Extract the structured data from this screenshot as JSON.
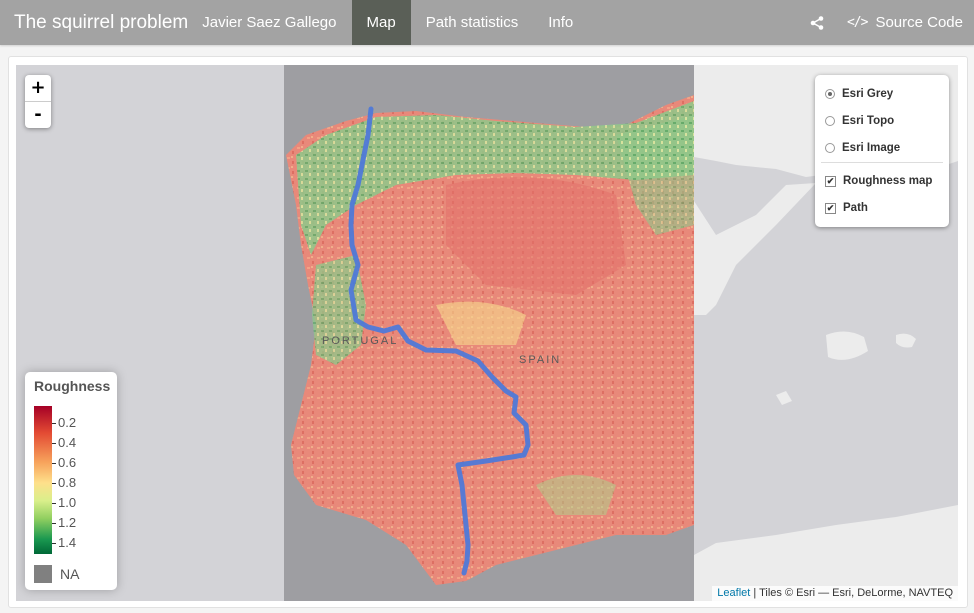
{
  "navbar": {
    "title": "The squirrel problem",
    "author": "Javier Saez Gallego",
    "tabs": [
      {
        "label": "Map",
        "active": true
      },
      {
        "label": "Path statistics",
        "active": false
      },
      {
        "label": "Info",
        "active": false
      }
    ],
    "share_icon": "share-icon",
    "source_icon_glyph": "</>",
    "source_label": "Source Code"
  },
  "map": {
    "zoom_in": "+",
    "zoom_out": "-",
    "country_labels": [
      "PORTUGAL",
      "SPAIN"
    ],
    "layers": {
      "base": [
        {
          "label": "Esri Grey",
          "selected": true
        },
        {
          "label": "Esri Topo",
          "selected": false
        },
        {
          "label": "Esri Image",
          "selected": false
        }
      ],
      "overlays": [
        {
          "label": "Roughness map",
          "checked": true
        },
        {
          "label": "Path",
          "checked": true
        }
      ]
    },
    "attribution": {
      "link": "Leaflet",
      "text": " | Tiles © Esri — Esri, DeLorme, NAVTEQ"
    },
    "colors": {
      "path": "#4f79d8",
      "sea": "#d3d3d7",
      "land_outside": "#ececec",
      "roughness_bg": "#e77b6e"
    }
  },
  "legend": {
    "title": "Roughness",
    "ticks": [
      "0.2",
      "0.4",
      "0.6",
      "0.8",
      "1.0",
      "1.2",
      "1.4"
    ],
    "na_label": "NA",
    "colors": {
      "high": "#a50026",
      "mid": "#fee08b",
      "low": "#006837",
      "na": "#808080"
    }
  }
}
